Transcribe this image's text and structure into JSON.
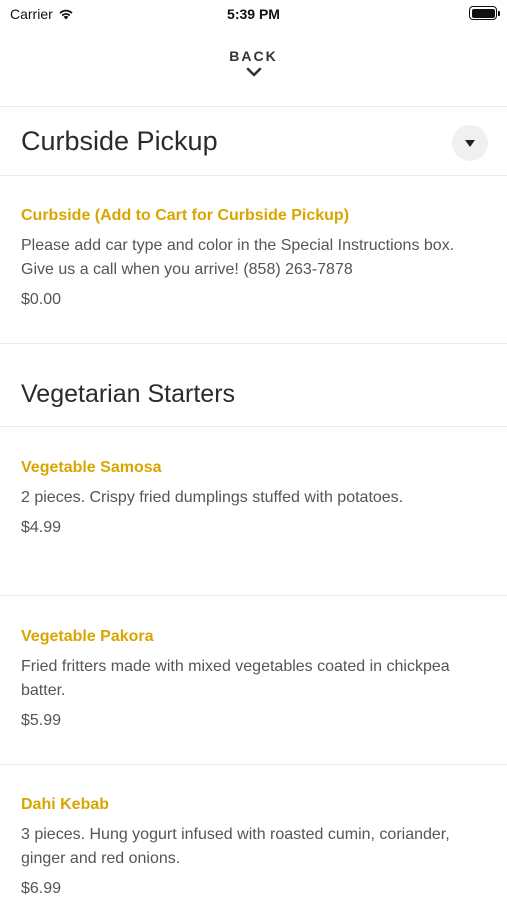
{
  "status_bar": {
    "carrier": "Carrier",
    "time": "5:39 PM"
  },
  "nav": {
    "back_label": "BACK"
  },
  "sections": [
    {
      "title": "Curbside Pickup",
      "items": [
        {
          "name": "Curbside (Add to Cart for Curbside Pickup)",
          "description": "Please add car type and color in the Special Instructions box. Give us a call when you arrive! (858) 263-7878",
          "price": "$0.00"
        }
      ]
    },
    {
      "title": "Vegetarian Starters",
      "items": [
        {
          "name": "Vegetable Samosa",
          "description": "2 pieces. Crispy fried dumplings stuffed with potatoes.",
          "price": "$4.99"
        },
        {
          "name": "Vegetable Pakora",
          "description": "Fried fritters made with mixed vegetables coated in chickpea batter.",
          "price": "$5.99"
        },
        {
          "name": "Dahi Kebab",
          "description": "3 pieces. Hung yogurt infused with roasted cumin, coriander, ginger and red onions.",
          "price": "$6.99"
        }
      ]
    }
  ],
  "colors": {
    "item_name": "#d9a500",
    "text": "#555555",
    "header": "#2b2b2b",
    "divider": "#ececec"
  },
  "icons": {
    "wifi": "wifi-icon",
    "battery": "battery-icon",
    "back": "chevron-down-icon",
    "collapse": "caret-down-icon"
  }
}
